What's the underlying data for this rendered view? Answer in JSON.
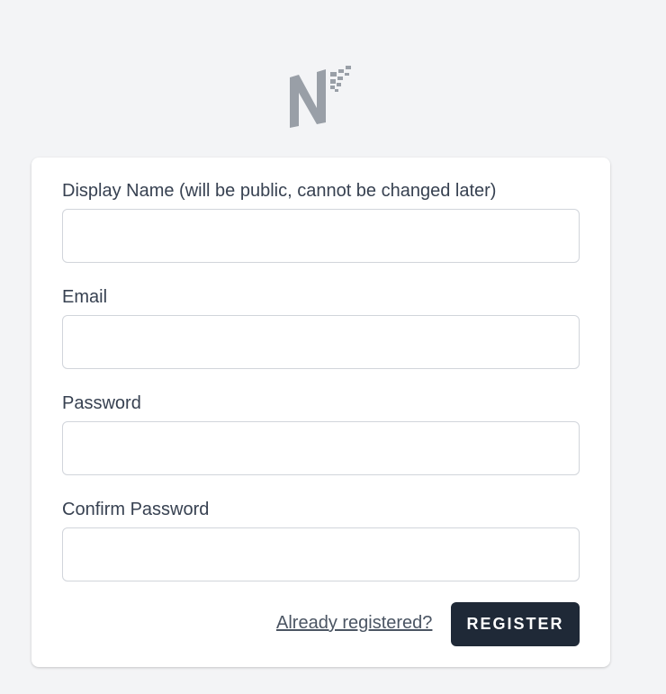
{
  "logo": {
    "icon": "nf-logo-icon",
    "color": "#999fa7"
  },
  "form": {
    "fields": [
      {
        "label": "Display Name (will be public, cannot be changed later)",
        "value": "",
        "type": "text"
      },
      {
        "label": "Email",
        "value": "",
        "type": "email"
      },
      {
        "label": "Password",
        "value": "",
        "type": "password"
      },
      {
        "label": "Confirm Password",
        "value": "",
        "type": "password"
      }
    ],
    "login_link": "Already registered?",
    "register_label": "REGISTER"
  },
  "colors": {
    "background": "#f3f4f6",
    "card": "#ffffff",
    "button": "#1f2937",
    "label_text": "#374151",
    "input_border": "#d1d5db"
  }
}
